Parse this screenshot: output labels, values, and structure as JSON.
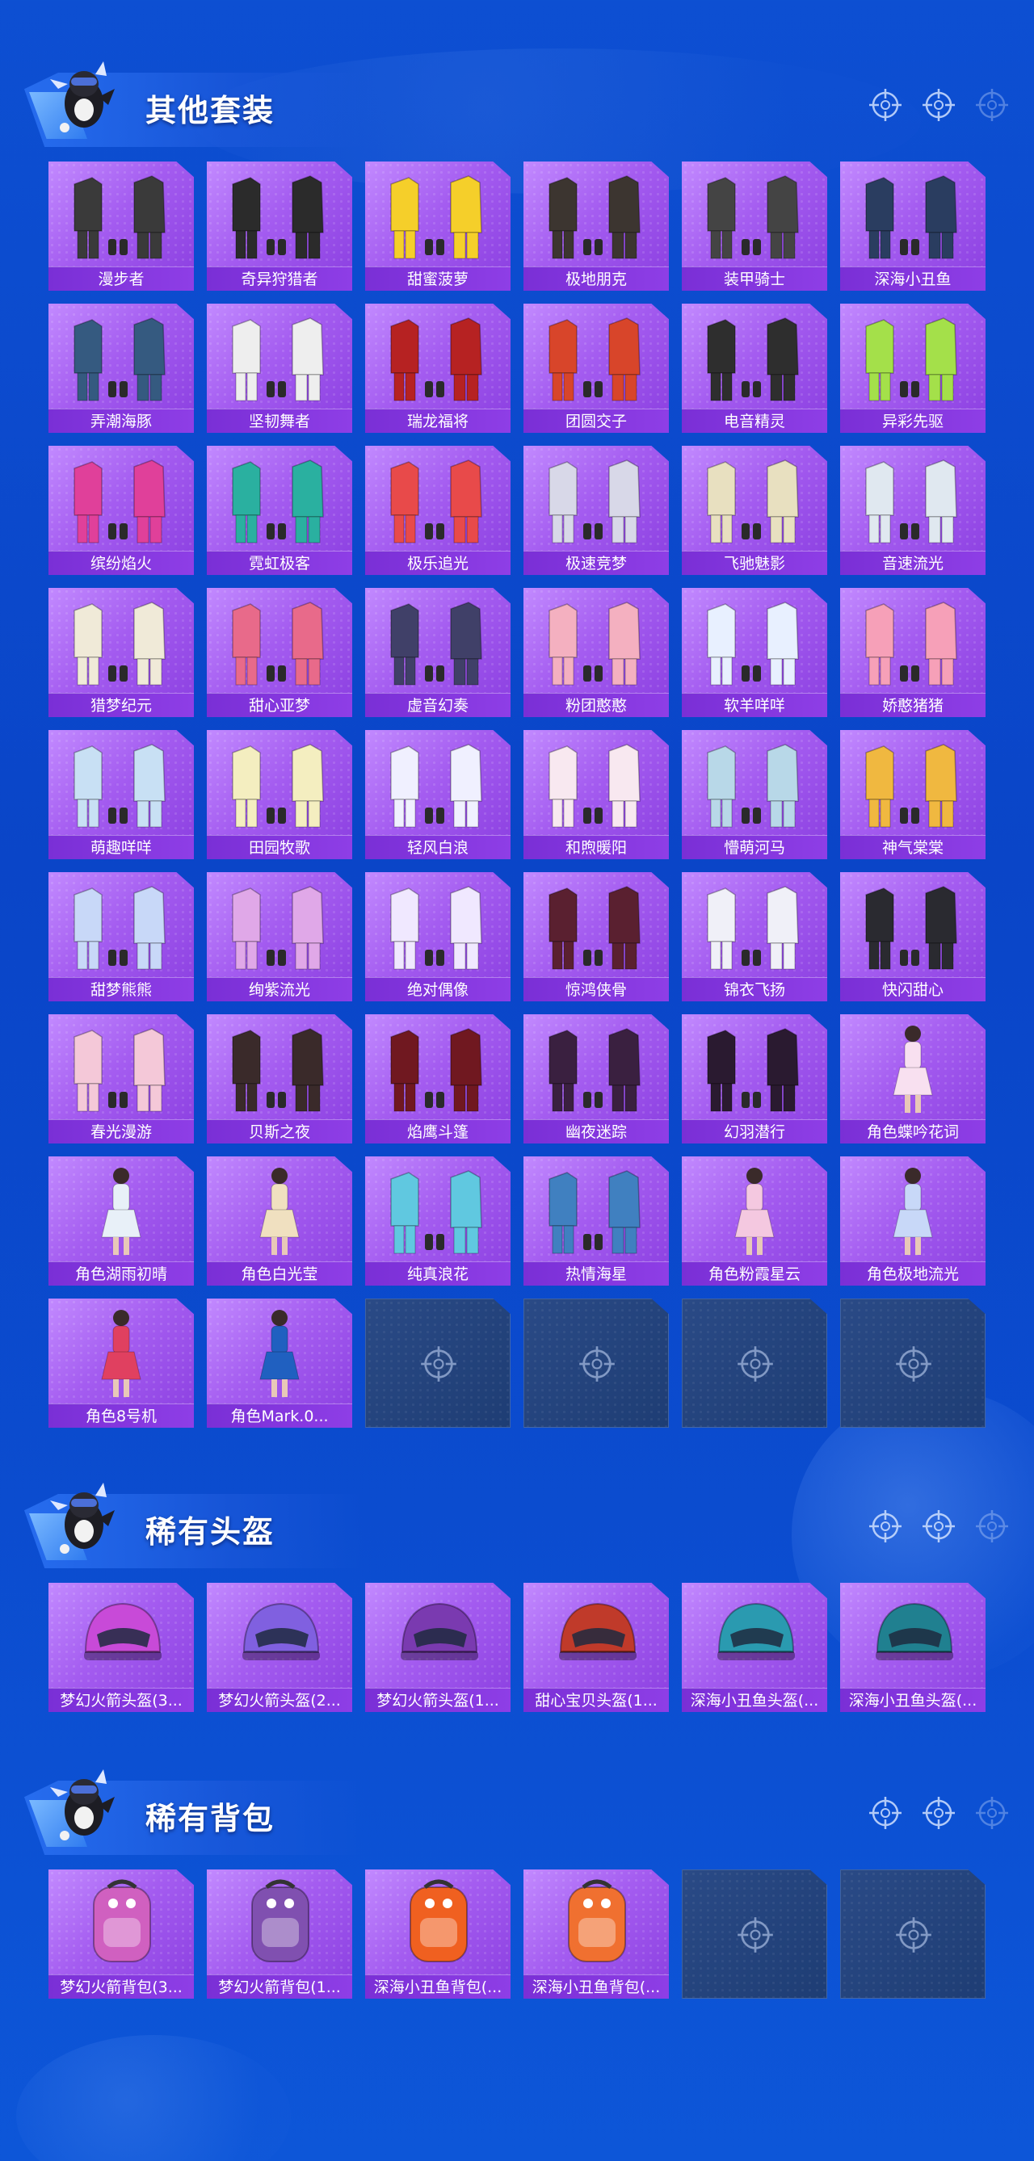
{
  "colors": {
    "card_purple": "#a45cf0",
    "label_bar": "#7a2fd6",
    "background_blue": "#0b4ccf",
    "empty_slot": "#22427c"
  },
  "sections": [
    {
      "title": "其他套装",
      "items": [
        {
          "label": "漫步者",
          "icon": "outfit-icon",
          "tone": "#3a3a3a"
        },
        {
          "label": "奇异狩猎者",
          "icon": "outfit-icon",
          "tone": "#2b2b2b"
        },
        {
          "label": "甜蜜菠萝",
          "icon": "outfit-icon",
          "tone": "#f5cf2a"
        },
        {
          "label": "极地朋克",
          "icon": "outfit-icon",
          "tone": "#3c3530"
        },
        {
          "label": "装甲骑士",
          "icon": "outfit-icon",
          "tone": "#444444"
        },
        {
          "label": "深海小丑鱼",
          "icon": "outfit-icon",
          "tone": "#2a3d60"
        },
        {
          "label": "弄潮海豚",
          "icon": "outfit-icon",
          "tone": "#355a80"
        },
        {
          "label": "坚韧舞者",
          "icon": "outfit-icon",
          "tone": "#eeeeee"
        },
        {
          "label": "瑞龙福将",
          "icon": "outfit-icon",
          "tone": "#b62222"
        },
        {
          "label": "团圆交子",
          "icon": "outfit-icon",
          "tone": "#d8452a"
        },
        {
          "label": "电音精灵",
          "icon": "outfit-icon",
          "tone": "#2e2e2e"
        },
        {
          "label": "异彩先驱",
          "icon": "outfit-icon",
          "tone": "#a4e04a"
        },
        {
          "label": "缤纷焰火",
          "icon": "outfit-icon",
          "tone": "#e0409a"
        },
        {
          "label": "霓虹极客",
          "icon": "outfit-icon",
          "tone": "#2ab0a0"
        },
        {
          "label": "极乐追光",
          "icon": "outfit-icon",
          "tone": "#e84a4a"
        },
        {
          "label": "极速竞梦",
          "icon": "outfit-icon",
          "tone": "#d8d8e8"
        },
        {
          "label": "飞驰魅影",
          "icon": "outfit-icon",
          "tone": "#e8e0c0"
        },
        {
          "label": "音速流光",
          "icon": "outfit-icon",
          "tone": "#e0e8f0"
        },
        {
          "label": "猎梦纪元",
          "icon": "outfit-icon",
          "tone": "#f0ead8"
        },
        {
          "label": "甜心亚梦",
          "icon": "outfit-icon",
          "tone": "#e86a8a"
        },
        {
          "label": "虚音幻奏",
          "icon": "outfit-icon",
          "tone": "#404068"
        },
        {
          "label": "粉团憨憨",
          "icon": "outfit-icon",
          "tone": "#f4b0c0"
        },
        {
          "label": "软羊咩咩",
          "icon": "outfit-icon",
          "tone": "#e8f0ff"
        },
        {
          "label": "娇憨猪猪",
          "icon": "outfit-icon",
          "tone": "#f6a0b8"
        },
        {
          "label": "萌趣咩咩",
          "icon": "outfit-icon",
          "tone": "#c8e0f4"
        },
        {
          "label": "田园牧歌",
          "icon": "outfit-icon",
          "tone": "#f4eec0"
        },
        {
          "label": "轻风白浪",
          "icon": "outfit-icon",
          "tone": "#f0f0ff"
        },
        {
          "label": "和煦暖阳",
          "icon": "outfit-icon",
          "tone": "#f8e8f0"
        },
        {
          "label": "懵萌河马",
          "icon": "outfit-icon",
          "tone": "#b8d8e8"
        },
        {
          "label": "神气棠棠",
          "icon": "outfit-icon",
          "tone": "#f0b840"
        },
        {
          "label": "甜梦熊熊",
          "icon": "outfit-icon",
          "tone": "#c8d8f8"
        },
        {
          "label": "绚紫流光",
          "icon": "outfit-icon",
          "tone": "#e0a8e8"
        },
        {
          "label": "绝对偶像",
          "icon": "outfit-icon",
          "tone": "#f0e8ff"
        },
        {
          "label": "惊鸿侠骨",
          "icon": "outfit-icon",
          "tone": "#5a2030"
        },
        {
          "label": "锦衣飞扬",
          "icon": "outfit-icon",
          "tone": "#f0f0f8"
        },
        {
          "label": "快闪甜心",
          "icon": "outfit-icon",
          "tone": "#2a2a30"
        },
        {
          "label": "春光漫游",
          "icon": "outfit-icon",
          "tone": "#f4c8d8"
        },
        {
          "label": "贝斯之夜",
          "icon": "outfit-icon",
          "tone": "#3a2a2a"
        },
        {
          "label": "焰鹰斗篷",
          "icon": "outfit-icon",
          "tone": "#701820"
        },
        {
          "label": "幽夜迷踪",
          "icon": "outfit-icon",
          "tone": "#3a2040"
        },
        {
          "label": "幻羽潜行",
          "icon": "outfit-icon",
          "tone": "#2a1a30"
        },
        {
          "label": "角色蝶吟花词",
          "icon": "character-icon",
          "tone": "#f8e0f0"
        },
        {
          "label": "角色湖雨初晴",
          "icon": "character-icon",
          "tone": "#e8f0f8"
        },
        {
          "label": "角色白光莹",
          "icon": "character-icon",
          "tone": "#f0e0c0"
        },
        {
          "label": "纯真浪花",
          "icon": "outfit-icon",
          "tone": "#60c8e0"
        },
        {
          "label": "热情海星",
          "icon": "outfit-icon",
          "tone": "#4080c0"
        },
        {
          "label": "角色粉霞星云",
          "icon": "character-icon",
          "tone": "#f4c8e0"
        },
        {
          "label": "角色极地流光",
          "icon": "character-icon",
          "tone": "#c8d8f8"
        },
        {
          "label": "角色8号机",
          "icon": "character-icon",
          "tone": "#e04060"
        },
        {
          "label": "角色Mark.0...",
          "icon": "character-icon",
          "tone": "#2060c0"
        },
        {
          "label": "",
          "icon": "empty-slot-icon",
          "empty": true
        },
        {
          "label": "",
          "icon": "empty-slot-icon",
          "empty": true
        },
        {
          "label": "",
          "icon": "empty-slot-icon",
          "empty": true
        },
        {
          "label": "",
          "icon": "empty-slot-icon",
          "empty": true
        }
      ]
    },
    {
      "title": "稀有头盔",
      "items": [
        {
          "label": "梦幻火箭头盔(3...",
          "icon": "helmet-icon",
          "tone": "#c84ad8"
        },
        {
          "label": "梦幻火箭头盔(2...",
          "icon": "helmet-icon",
          "tone": "#8060e0"
        },
        {
          "label": "梦幻火箭头盔(1...",
          "icon": "helmet-icon",
          "tone": "#7a3ab0"
        },
        {
          "label": "甜心宝贝头盔(1...",
          "icon": "helmet-icon",
          "tone": "#c03a2a"
        },
        {
          "label": "深海小丑鱼头盔(...",
          "icon": "helmet-icon",
          "tone": "#2a9ab0"
        },
        {
          "label": "深海小丑鱼头盔(...",
          "icon": "helmet-icon",
          "tone": "#208090"
        }
      ]
    },
    {
      "title": "稀有背包",
      "items": [
        {
          "label": "梦幻火箭背包(3...",
          "icon": "backpack-icon",
          "tone": "#d060c0"
        },
        {
          "label": "梦幻火箭背包(1...",
          "icon": "backpack-icon",
          "tone": "#8050b0"
        },
        {
          "label": "深海小丑鱼背包(...",
          "icon": "backpack-icon",
          "tone": "#f06020"
        },
        {
          "label": "深海小丑鱼背包(...",
          "icon": "backpack-icon",
          "tone": "#f07030"
        },
        {
          "label": "",
          "icon": "empty-slot-icon",
          "empty": true
        },
        {
          "label": "",
          "icon": "empty-slot-icon",
          "empty": true
        }
      ]
    }
  ]
}
